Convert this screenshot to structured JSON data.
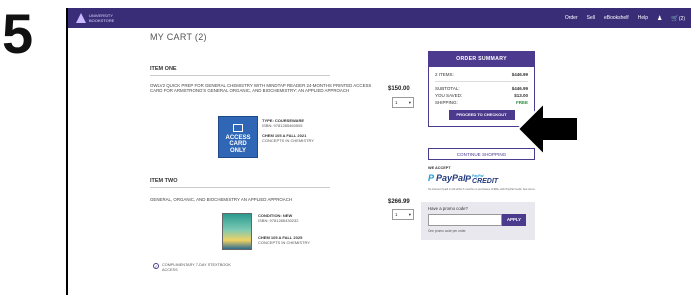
{
  "step_label": "5",
  "header": {
    "logo_text": "UNIVERSITY BOOKSTORE",
    "nav": [
      "Order",
      "Sell",
      "eBookshelf",
      "Help"
    ],
    "cart_count": "(2)"
  },
  "cart": {
    "title": "MY CART (2)",
    "items": [
      {
        "header": "ITEM ONE",
        "title": "OWLV2 QUICK PREP FOR GENERAL CHEMISTRY WITH MINDTAP READER 24-MONTHS PRINTED ACCESS CARD FOR ARMSTRONG'S GENERAL ORGANIC, AND BIOCHEMISTRY: AN APPLIED APPROACH",
        "price": "$150.00",
        "qty": "1",
        "type_label": "TYPE: COURSEWARE",
        "isbn": "ISBN: 9781285460505",
        "course": "CHEM 105 A  FALL 2021",
        "course_name": "CONCEPTS IN CHEMISTRY",
        "card_text": [
          "ACCESS",
          "CARD",
          "ONLY"
        ]
      },
      {
        "header": "ITEM TWO",
        "title": "GENERAL, ORGANIC, AND BIOCHEMISTRY AN APPLIED APPROACH",
        "price": "$266.99",
        "qty": "1",
        "condition": "CONDITION: NEW",
        "isbn": "ISBN: 9781285430232",
        "course": "CHEM 105 A  FALL 2025",
        "course_name": "CONCEPTS IN CHEMISTRY"
      }
    ],
    "complimentary": "COMPLIMENTARY 7-DAY STEXTBOOK ACCESS"
  },
  "summary": {
    "title": "ORDER SUMMARY",
    "items_label": "2 ITEMS:",
    "items_value": "$446.99",
    "subtotal_label": "SUBTOTAL:",
    "subtotal_value": "$446.99",
    "saved_label": "YOU SAVED:",
    "saved_value": "$13.00",
    "shipping_label": "SHIPPING:",
    "shipping_value": "FREE",
    "checkout_label": "PROCEED TO CHECKOUT",
    "continue_label": "CONTINUE SHOPPING"
  },
  "payment": {
    "we_accept": "WE ACCEPT",
    "paypal": "PayPal",
    "paypal_credit_small": "PayPal",
    "paypal_credit": "CREDIT",
    "note": "No interest if paid in full within 6 months on purchases of $99+ with PayPal Credit. See terms."
  },
  "promo": {
    "label": "Have a promo code?",
    "apply_label": "APPLY",
    "note": "One promo code per order."
  },
  "colors": {
    "brand": "#3a2d78",
    "accent": "#4b3a8e",
    "card_blue": "#2f66b6"
  }
}
